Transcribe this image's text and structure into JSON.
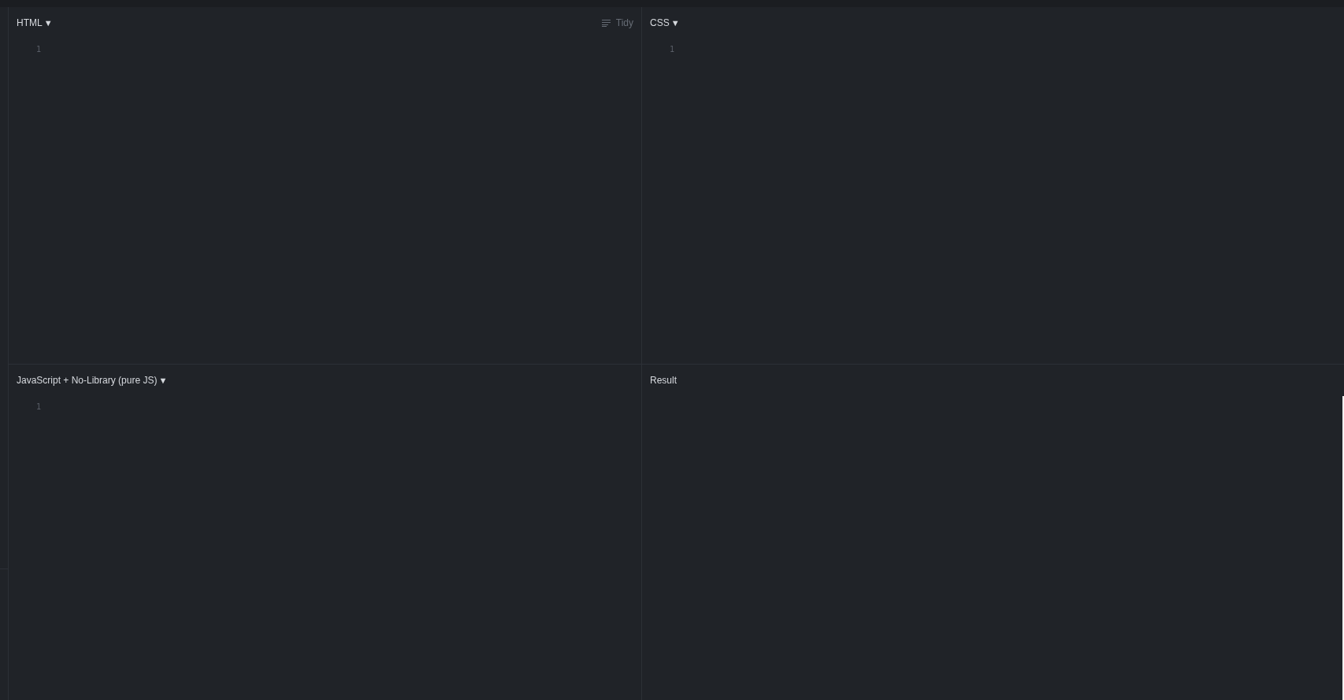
{
  "panels": [
    {
      "kind": "editor",
      "title": "HTML",
      "caret": "▼",
      "line_numbers": [
        "1"
      ],
      "tidy": {
        "label": "Tidy",
        "disabled": true
      }
    },
    {
      "kind": "editor",
      "title": "CSS",
      "caret": "▼",
      "line_numbers": [
        "1"
      ]
    },
    {
      "kind": "editor",
      "title": "JavaScript + No-Library (pure JS)",
      "caret": "▼",
      "line_numbers": [
        "1"
      ]
    },
    {
      "kind": "result",
      "title": "Result"
    }
  ]
}
